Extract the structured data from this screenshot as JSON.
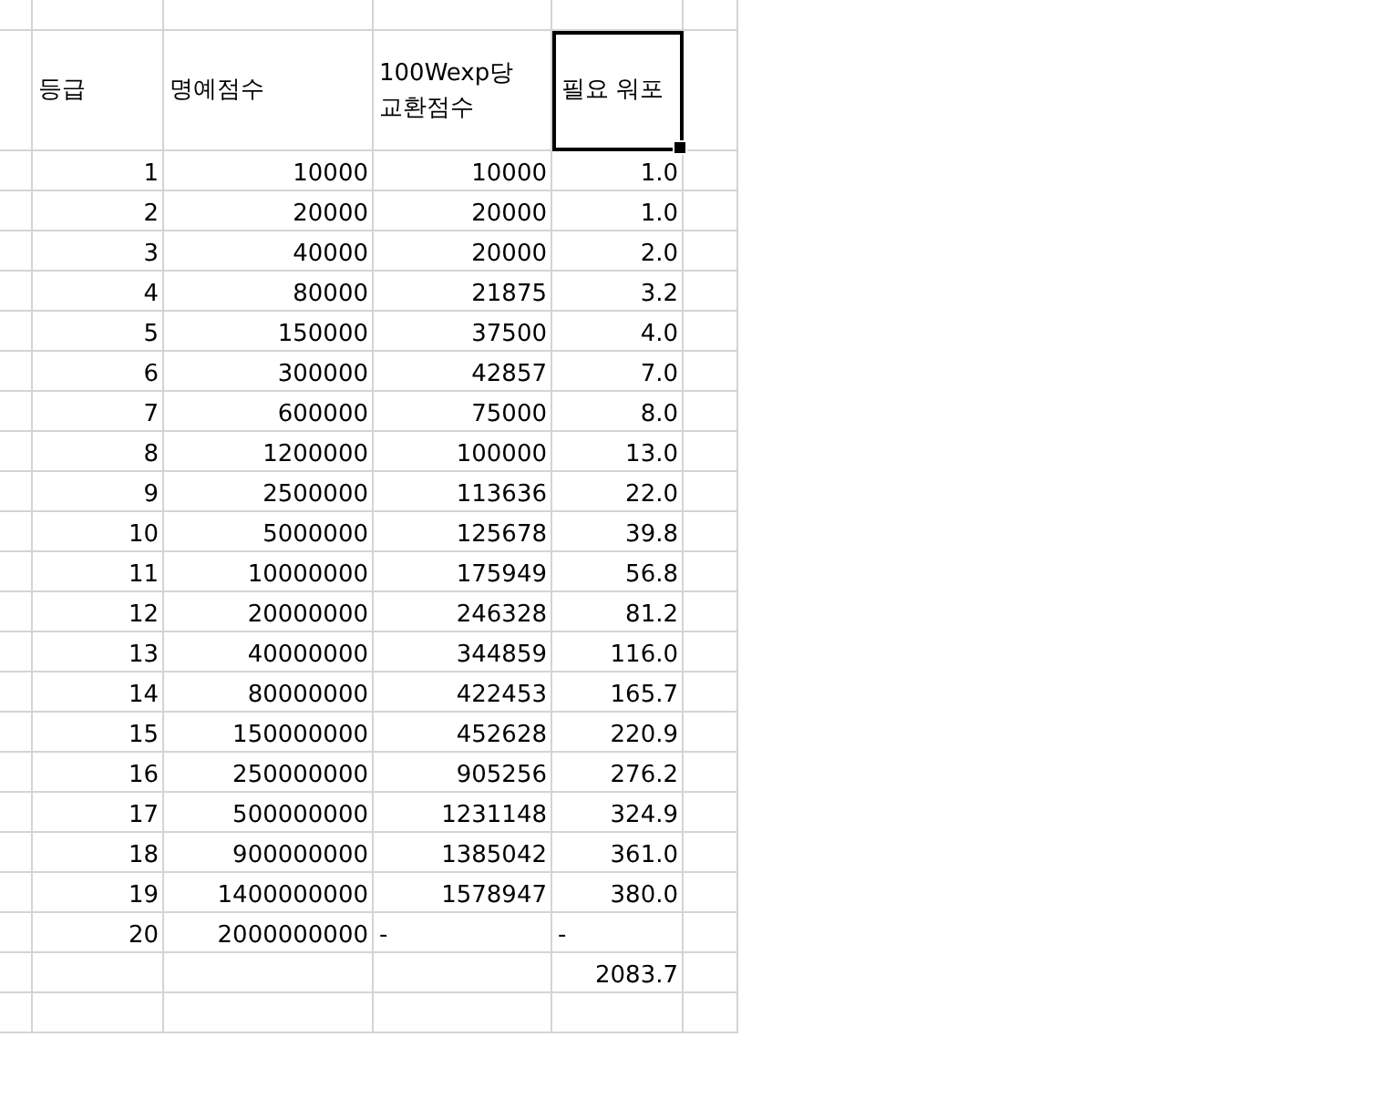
{
  "columns": [
    {
      "label": "등급",
      "selected": false
    },
    {
      "label": "명예점수",
      "selected": false
    },
    {
      "label": "100Wexp당 교환점수",
      "selected": false
    },
    {
      "label": "필요 워포",
      "selected": true
    }
  ],
  "rows": [
    {
      "grade": "1",
      "honor": "10000",
      "exchange": "10000",
      "warpo": "1.0"
    },
    {
      "grade": "2",
      "honor": "20000",
      "exchange": "20000",
      "warpo": "1.0"
    },
    {
      "grade": "3",
      "honor": "40000",
      "exchange": "20000",
      "warpo": "2.0"
    },
    {
      "grade": "4",
      "honor": "80000",
      "exchange": "21875",
      "warpo": "3.2"
    },
    {
      "grade": "5",
      "honor": "150000",
      "exchange": "37500",
      "warpo": "4.0"
    },
    {
      "grade": "6",
      "honor": "300000",
      "exchange": "42857",
      "warpo": "7.0"
    },
    {
      "grade": "7",
      "honor": "600000",
      "exchange": "75000",
      "warpo": "8.0"
    },
    {
      "grade": "8",
      "honor": "1200000",
      "exchange": "100000",
      "warpo": "13.0"
    },
    {
      "grade": "9",
      "honor": "2500000",
      "exchange": "113636",
      "warpo": "22.0"
    },
    {
      "grade": "10",
      "honor": "5000000",
      "exchange": "125678",
      "warpo": "39.8"
    },
    {
      "grade": "11",
      "honor": "10000000",
      "exchange": "175949",
      "warpo": "56.8"
    },
    {
      "grade": "12",
      "honor": "20000000",
      "exchange": "246328",
      "warpo": "81.2"
    },
    {
      "grade": "13",
      "honor": "40000000",
      "exchange": "344859",
      "warpo": "116.0"
    },
    {
      "grade": "14",
      "honor": "80000000",
      "exchange": "422453",
      "warpo": "165.7"
    },
    {
      "grade": "15",
      "honor": "150000000",
      "exchange": "452628",
      "warpo": "220.9"
    },
    {
      "grade": "16",
      "honor": "250000000",
      "exchange": "905256",
      "warpo": "276.2"
    },
    {
      "grade": "17",
      "honor": "500000000",
      "exchange": "1231148",
      "warpo": "324.9"
    },
    {
      "grade": "18",
      "honor": "900000000",
      "exchange": "1385042",
      "warpo": "361.0"
    },
    {
      "grade": "19",
      "honor": "1400000000",
      "exchange": "1578947",
      "warpo": "380.0"
    },
    {
      "grade": "20",
      "honor": "2000000000",
      "exchange": {
        "value": "-",
        "kind": "text"
      },
      "warpo": {
        "value": "-",
        "kind": "text"
      }
    }
  ],
  "total": {
    "warpo": "2083.7"
  }
}
